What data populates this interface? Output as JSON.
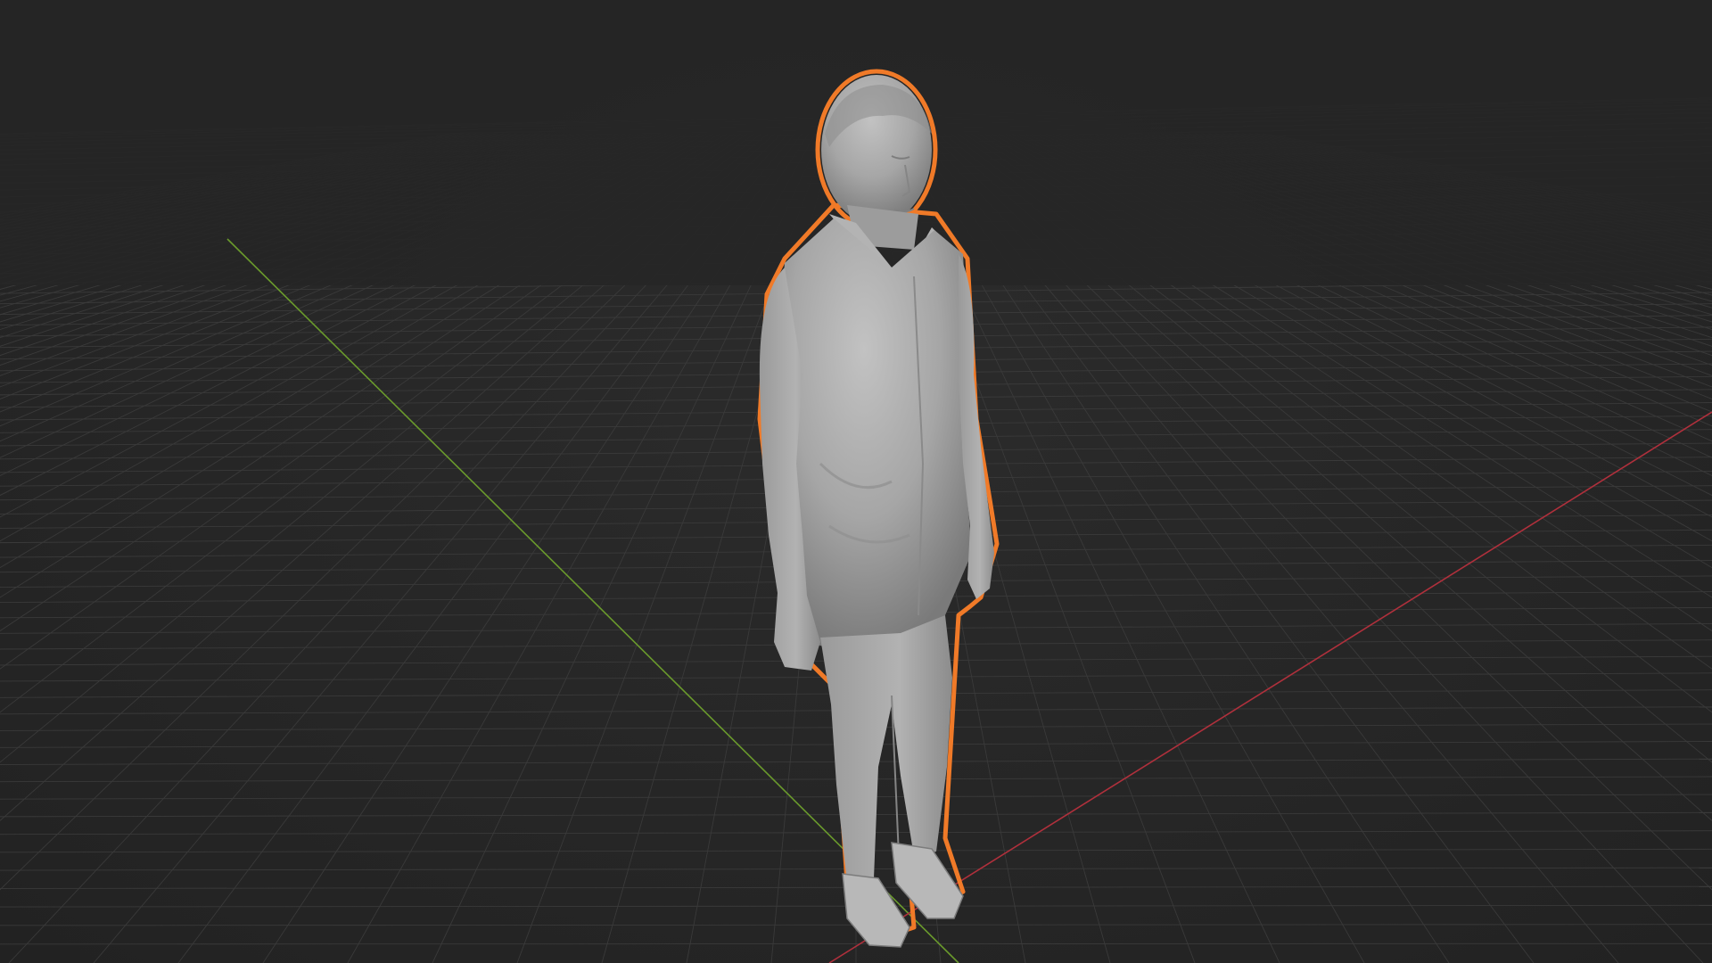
{
  "app": {
    "kind": "3d-viewport",
    "shading": "solid",
    "visible_text": []
  },
  "viewport": {
    "background_color": "#262626",
    "grid_color": "#3a3a3a",
    "x_axis_color": "#b0303c",
    "y_axis_color": "#6a9a2c",
    "selection_outline_color": "#f07a28",
    "model_color": "#a3a3a3"
  },
  "selected_object": {
    "name_visible": false,
    "is_selected": true
  }
}
